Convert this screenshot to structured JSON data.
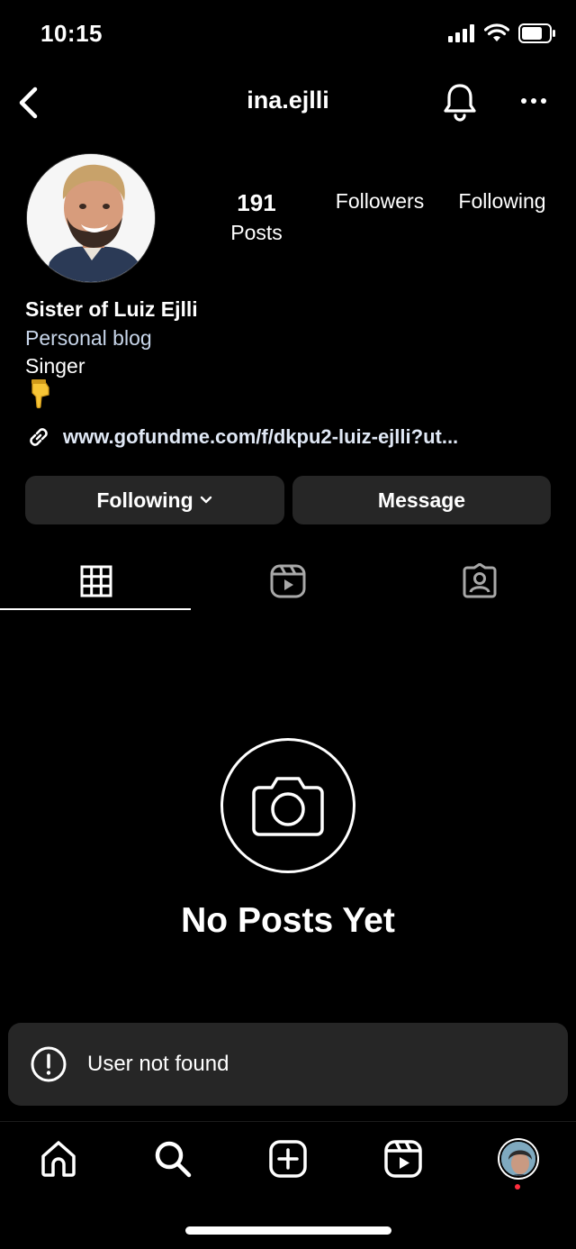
{
  "status_bar": {
    "time": "10:15",
    "icons": [
      "signal-icon",
      "wifi-icon",
      "battery-icon"
    ]
  },
  "header": {
    "username": "ina.ejlli",
    "icons": [
      "chevron-left-icon",
      "bell-icon",
      "more-icon"
    ]
  },
  "profile": {
    "stats": {
      "posts_count": "191",
      "posts_label": "Posts",
      "followers_label": "Followers",
      "following_label": "Following"
    },
    "bio": {
      "name": "Sister of Luiz Ejlli",
      "category": "Personal blog",
      "text": "Singer",
      "emoji": "pointing-down-hand-icon"
    },
    "link": "www.gofundme.com/f/dkpu2-luiz-ejlli?ut..."
  },
  "actions": {
    "following_label": "Following",
    "message_label": "Message"
  },
  "tabs": [
    {
      "name": "grid",
      "icon": "grid-icon",
      "active": true
    },
    {
      "name": "reels",
      "icon": "reels-icon",
      "active": false
    },
    {
      "name": "tagged",
      "icon": "tagged-icon",
      "active": false
    }
  ],
  "empty_state": {
    "icon": "camera-icon",
    "title": "No Posts Yet"
  },
  "toast": {
    "icon": "alert-circle-icon",
    "message": "User not found"
  },
  "bottom_nav": {
    "items": [
      "home-icon",
      "search-icon",
      "create-icon",
      "reels-icon",
      "profile-avatar"
    ],
    "notification_dot_color": "#ff2d3d"
  },
  "colors": {
    "background": "#000000",
    "button_bg": "#262626",
    "category_text": "#c8d6ea"
  }
}
